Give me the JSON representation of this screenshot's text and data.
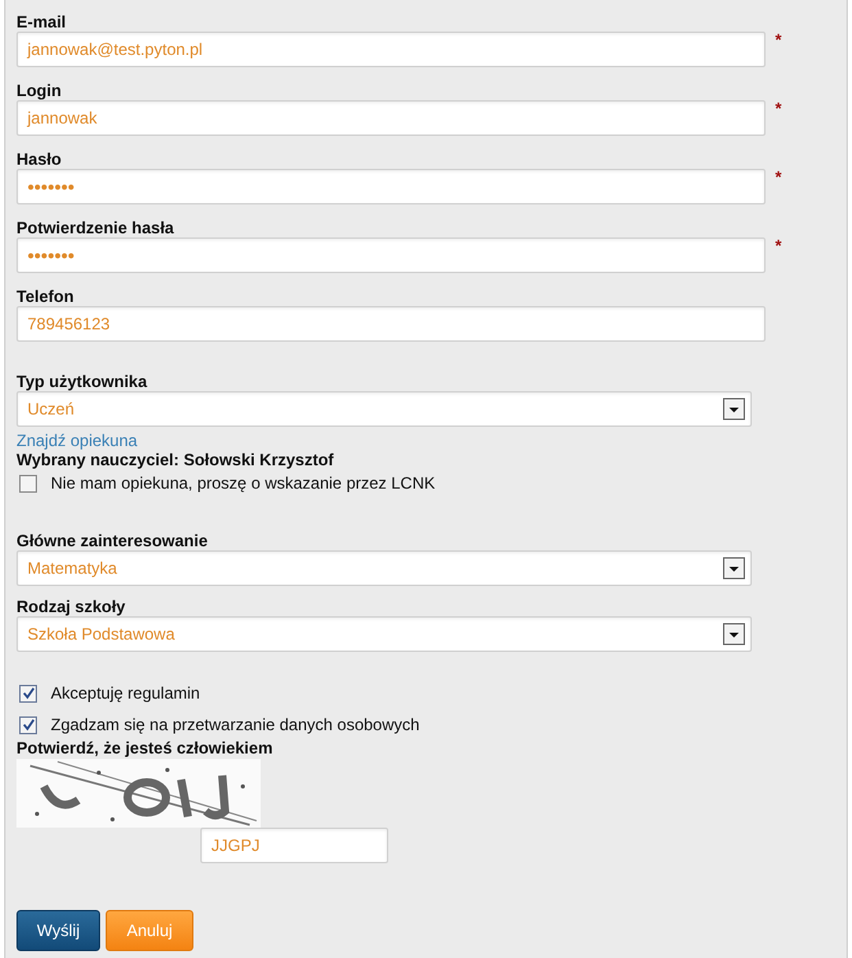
{
  "fields": [
    {
      "label": "E-mail",
      "value": "jannowak@test.pyton.pl",
      "kind": "text",
      "required_marker": "*"
    },
    {
      "label": "Login",
      "value": "jannowak",
      "kind": "text",
      "required_marker": "*"
    },
    {
      "label": "Hasło",
      "value": "•••••••",
      "kind": "password",
      "required_marker": "*"
    },
    {
      "label": "Potwierdzenie hasła",
      "value": "•••••••",
      "kind": "password",
      "required_marker": "*"
    },
    {
      "label": "Telefon",
      "value": "789456123",
      "kind": "text"
    }
  ],
  "user_type": {
    "label": "Typ użytkownika",
    "value": "Uczeń"
  },
  "find_guardian_link": "Znajdź opiekuna",
  "selected_teacher": "Wybrany nauczyciel: Sołowski Krzysztof",
  "no_guardian": {
    "label": "Nie mam opiekuna, proszę o wskazanie przez LCNK",
    "checked": false
  },
  "selects": [
    {
      "label": "Główne zainteresowanie",
      "value": "Matematyka"
    },
    {
      "label": "Rodzaj szkoły",
      "value": "Szkoła Podstawowa"
    }
  ],
  "agreements": [
    {
      "label": "Akceptuję regulamin",
      "checked": true
    },
    {
      "label": "Zgadzam się na przetwarzanie danych osobowych",
      "checked": true
    }
  ],
  "captcha": {
    "label": "Potwierdź, że jesteś człowiekiem",
    "value": "JJGPJ"
  },
  "buttons": [
    {
      "label": "Wyślij",
      "kind": "primary"
    },
    {
      "label": "Anuluj",
      "kind": "cancel"
    }
  ]
}
